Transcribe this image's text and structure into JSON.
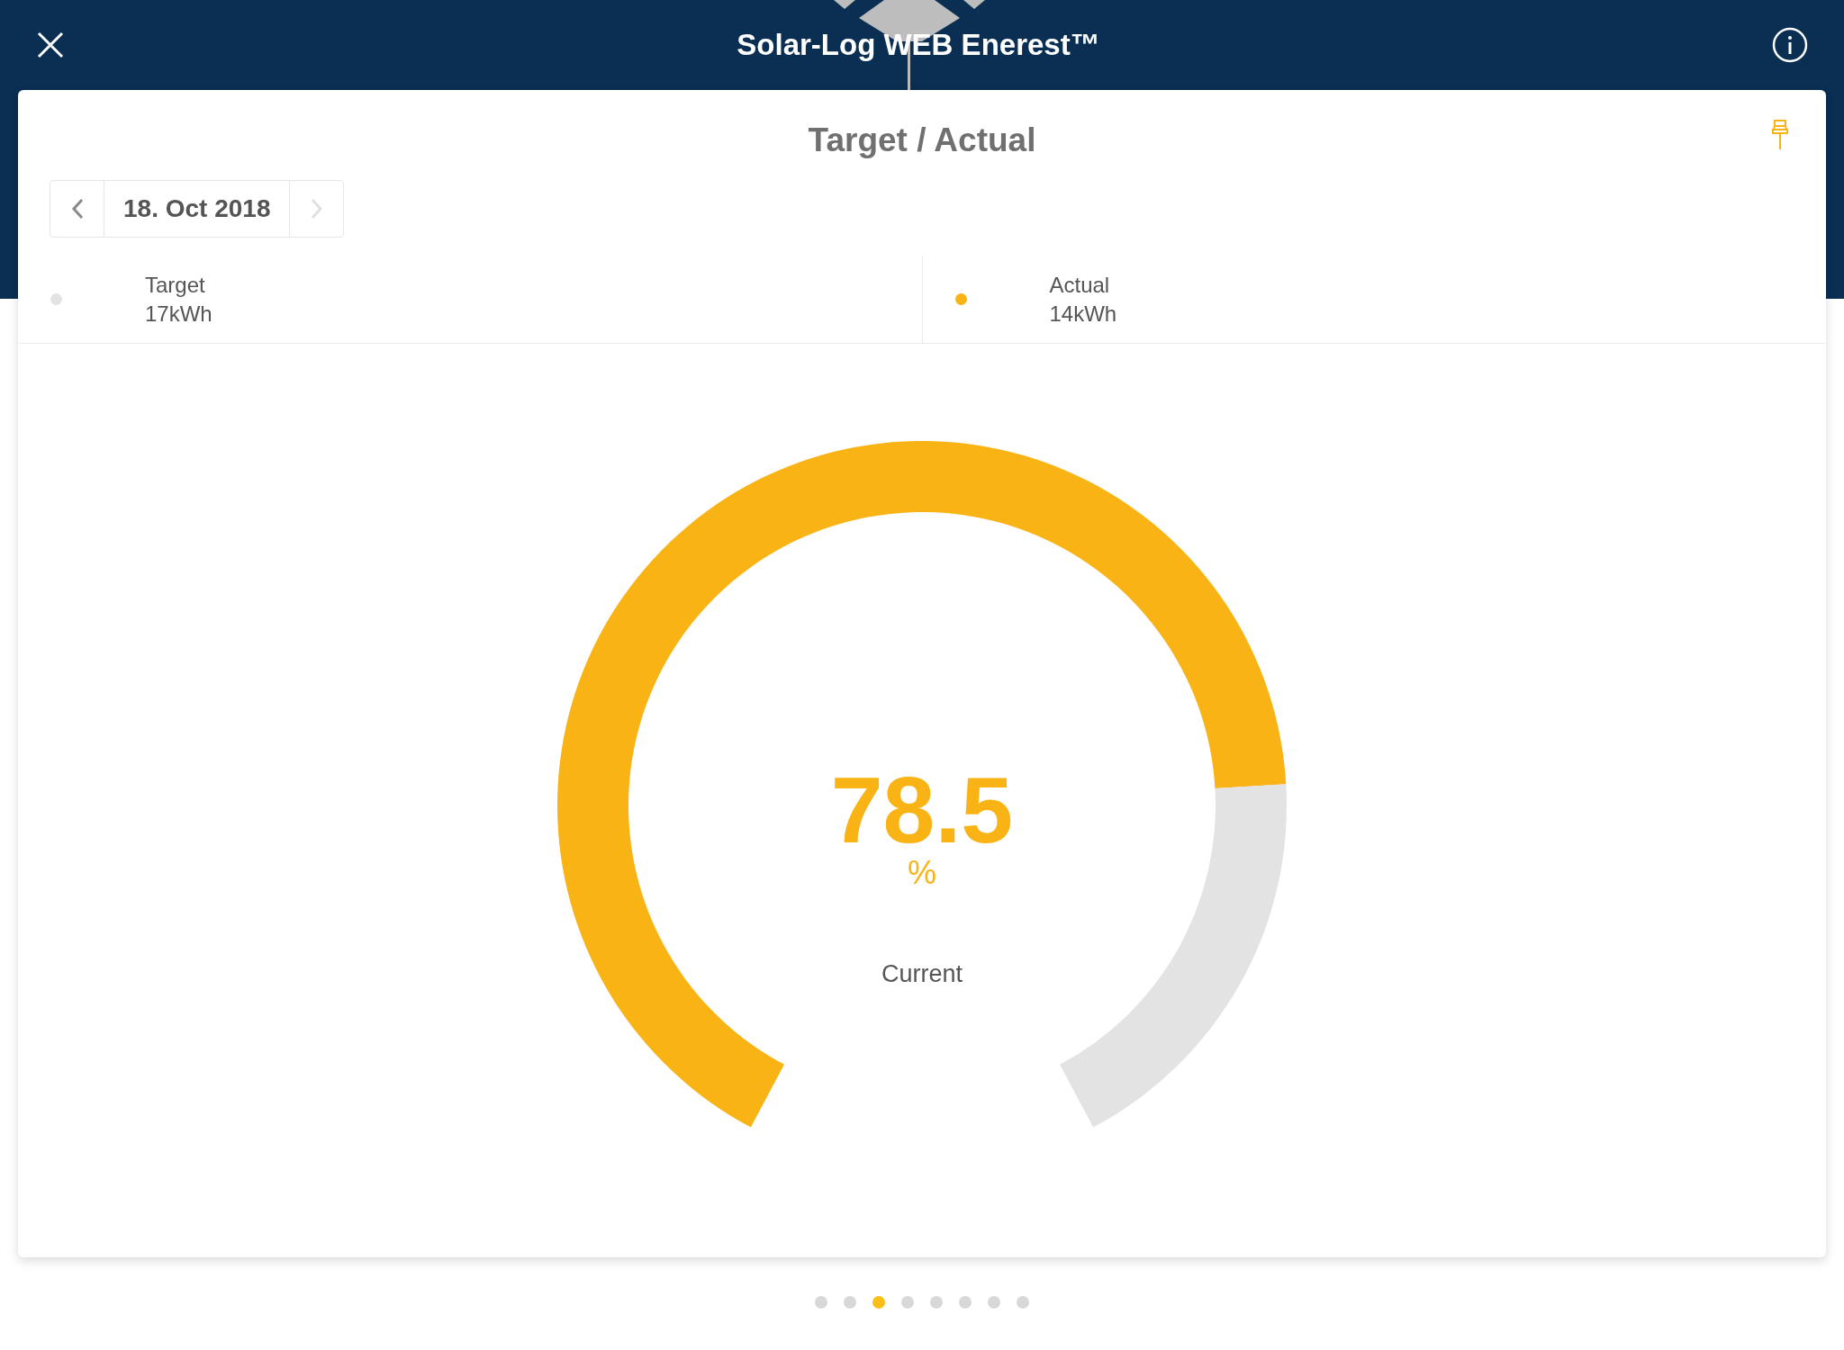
{
  "header": {
    "title": "Solar-Log WEB Enerest™"
  },
  "card": {
    "title": "Target / Actual"
  },
  "date_nav": {
    "date": "18. Oct 2018",
    "next_disabled": true
  },
  "legend": [
    {
      "label": "Target",
      "value": "17kWh",
      "color": "#e3e3e3"
    },
    {
      "label": "Actual",
      "value": "14kWh",
      "color": "#f9b314"
    }
  ],
  "gauge": {
    "reading": "78.5",
    "unit": "%",
    "caption": "Current",
    "chart_data": {
      "type": "donut",
      "values": [
        78.5,
        21.5
      ]
    }
  },
  "pages": [
    {
      "selected": false
    },
    {
      "selected": false
    },
    {
      "selected": true
    },
    {
      "selected": false
    },
    {
      "selected": false
    },
    {
      "selected": false
    },
    {
      "selected": false
    },
    {
      "selected": false
    }
  ]
}
